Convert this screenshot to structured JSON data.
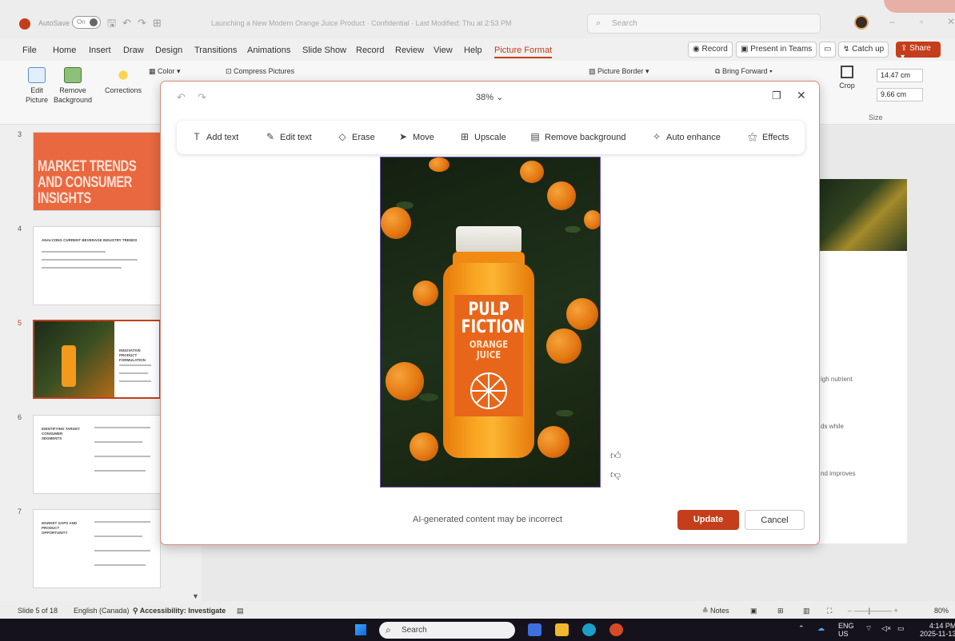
{
  "titlebar": {
    "autosave_label": "AutoSave",
    "autosave_state": "On",
    "doc_title": "Launching a New Modern Orange Juice Product  ·  Confidential  ·  Last Modified: Thu at 2:53 PM",
    "search_placeholder": "Search"
  },
  "menu": {
    "items": [
      "File",
      "Home",
      "Insert",
      "Draw",
      "Design",
      "Transitions",
      "Animations",
      "Slide Show",
      "Record",
      "Review",
      "View",
      "Help",
      "Picture Format"
    ],
    "record_btn": "Record",
    "teams_btn": "Present in Teams",
    "catchup_btn": "Catch up",
    "share_btn": "Share"
  },
  "ribbon": {
    "edit_picture": "Edit Picture",
    "remove_background": "Remove Background",
    "corrections": "Corrections",
    "color": "Color",
    "compress": "Compress Pictures",
    "picture_border": "Picture Border",
    "bring_forward": "Bring Forward",
    "crop": "Crop",
    "height": "14.47 cm",
    "width": "9.66 cm",
    "size_group": "Size"
  },
  "slides": {
    "numbers": [
      "3",
      "4",
      "5",
      "6",
      "7"
    ],
    "slide3_title": "MARKET TRENDS AND CONSUMER INSIGHTS",
    "slide4_title": "ANALYZING CURRENT BEVERAGE INDUSTRY TRENDS",
    "slide5_title": "INNOVATIVE PRODUCT FORMULATION",
    "slide6_title": "IDENTIFYING TARGET CONSUMER SEGMENTS",
    "slide7_title": "MARKET GAPS AND PRODUCT OPPORTUNITY"
  },
  "main_slide": {
    "snippet1": "igh nutrient",
    "snippet2": "ds while",
    "snippet3": "nd improves"
  },
  "dialog": {
    "zoom": "38%",
    "tools": [
      "Add text",
      "Edit text",
      "Erase",
      "Move",
      "Upscale",
      "Remove background",
      "Auto enhance",
      "Effects"
    ],
    "label_line1": "PULP",
    "label_line2": "FICTION",
    "label_line3": "ORANGE",
    "label_line4": "JUICE",
    "disclaimer": "AI-generated content may be incorrect",
    "update": "Update",
    "cancel": "Cancel"
  },
  "statusbar": {
    "slide_info": "Slide 5 of 18",
    "language": "English (Canada)",
    "accessibility": "Accessibility: Investigate",
    "notes": "Notes",
    "zoom": "80%"
  },
  "taskbar": {
    "search": "Search",
    "lang1": "ENG",
    "lang2": "US",
    "time": "4:14 PM",
    "date": "2025-11-13"
  },
  "colors": {
    "accent": "#c43e1c",
    "label_orange": "#e8661a"
  }
}
